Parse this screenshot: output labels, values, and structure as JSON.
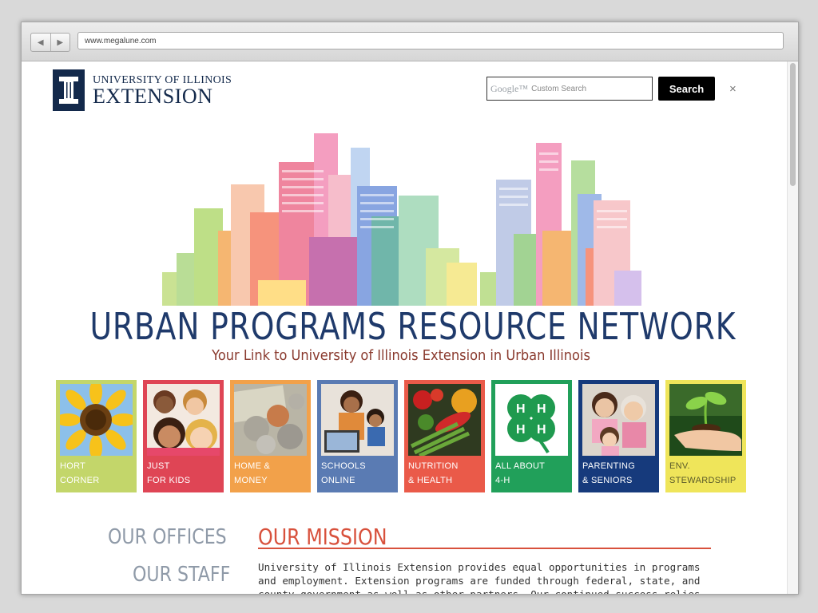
{
  "browser": {
    "url": "www.megalune.com"
  },
  "logo": {
    "line1": "UNIVERSITY OF ILLINOIS",
    "line2": "EXTENSION",
    "mark": "I"
  },
  "search": {
    "google_label": "Google™",
    "placeholder": "Custom Search",
    "button_label": "Search",
    "close_label": "×"
  },
  "hero": {
    "title": "URBAN PROGRAMS RESOURCE NETWORK",
    "subtitle": "Your Link to University of Illinois Extension in Urban Illinois"
  },
  "tiles": [
    {
      "line1": "HORT",
      "line2": "CORNER",
      "color": "#c3d66a",
      "icon": "sunflower-image"
    },
    {
      "line1": "JUST",
      "line2": "FOR KIDS",
      "color": "#df4555",
      "icon": "kids-image"
    },
    {
      "line1": "HOME &",
      "line2": "MONEY",
      "color": "#f2a14a",
      "icon": "money-image"
    },
    {
      "line1": "SCHOOLS",
      "line2": "ONLINE",
      "color": "#5a7bb3",
      "icon": "laptop-image"
    },
    {
      "line1": "NUTRITION",
      "line2": "& HEALTH",
      "color": "#ea5a49",
      "icon": "vegetables-image"
    },
    {
      "line1": "ALL ABOUT",
      "line2": "4-H",
      "color": "#21a05a",
      "icon": "clover-image"
    },
    {
      "line1": "PARENTING",
      "line2": "& SENIORS",
      "color": "#163a7c",
      "icon": "family-image"
    },
    {
      "line1": "ENV.",
      "line2": "STEWARDSHIP",
      "color": "#efe55a",
      "icon": "seedling-image"
    }
  ],
  "sidebar": {
    "offices": "OUR OFFICES",
    "staff": "OUR STAFF"
  },
  "mission": {
    "heading": "OUR MISSION",
    "text": "University of Illinois Extension provides equal opportunities in programs and employment. Extension programs are funded through federal, state, and county government as well as other partners. Our continued success relies on keeping our"
  }
}
